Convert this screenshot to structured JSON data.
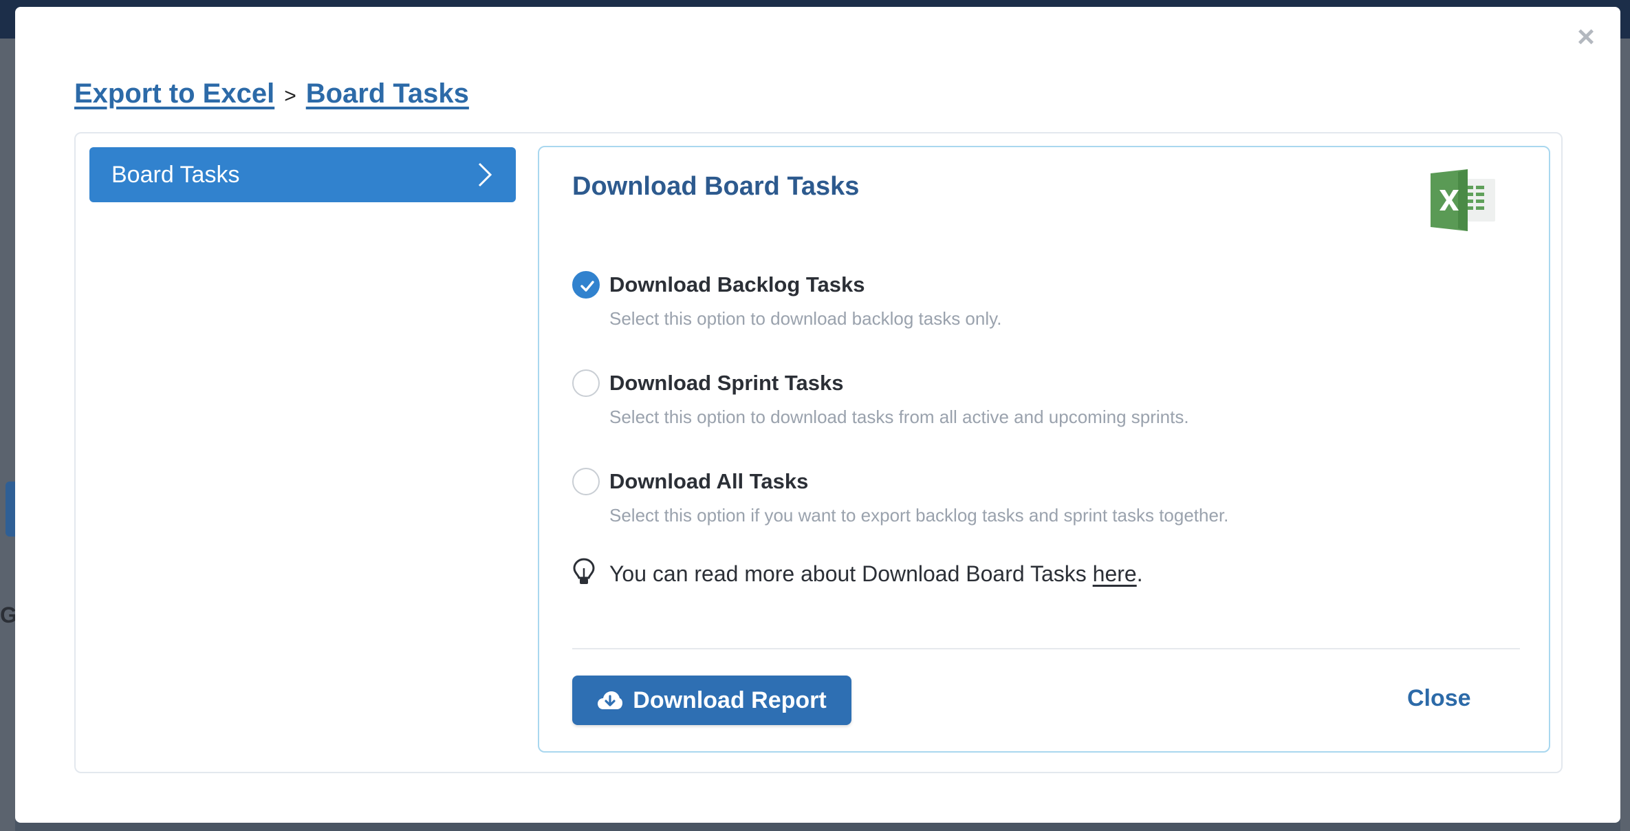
{
  "breadcrumb": {
    "root": "Export to Excel",
    "separator": ">",
    "current": "Board Tasks"
  },
  "close_x": "×",
  "sidebar": {
    "items": [
      {
        "label": "Board Tasks",
        "active": true
      }
    ]
  },
  "main": {
    "title": "Download Board Tasks",
    "options": [
      {
        "label": "Download Backlog Tasks",
        "description": "Select this option to download backlog tasks only.",
        "checked": true
      },
      {
        "label": "Download Sprint Tasks",
        "description": "Select this option to download tasks from all active and upcoming sprints.",
        "checked": false
      },
      {
        "label": "Download All Tasks",
        "description": "Select this option if you want to export backlog tasks and sprint tasks together.",
        "checked": false
      }
    ],
    "tip": {
      "text_before": "You can read more about Download Board Tasks ",
      "link": "here",
      "text_after": "."
    },
    "download_button": "Download Report",
    "close_button": "Close"
  },
  "backdrop": {
    "partial_letter": "G"
  },
  "colors": {
    "accent": "#3182ce",
    "link": "#2c6aa8",
    "title": "#2d5a8e",
    "excel_green": "#5fa05a"
  }
}
